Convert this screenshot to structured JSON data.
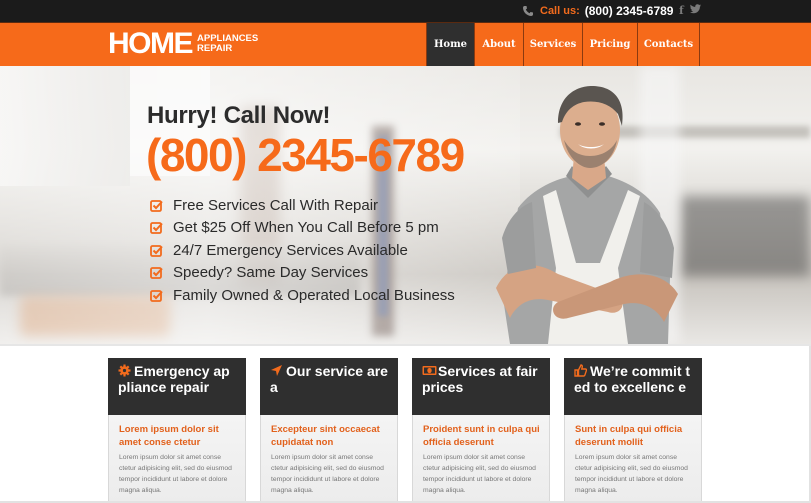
{
  "topbar": {
    "call_label": "Call us:",
    "call_number": "(800) 2345-6789",
    "social": [
      "f",
      "t"
    ],
    "icons": {
      "phone": "phone-icon",
      "facebook": "facebook-icon",
      "twitter": "twitter-icon"
    }
  },
  "header": {
    "logo_big": "HOME",
    "logo_line1": "APPLIANCES",
    "logo_line2": "REPAIR",
    "nav": [
      {
        "label": "Home",
        "active": true
      },
      {
        "label": "About",
        "active": false
      },
      {
        "label": "Services",
        "active": false
      },
      {
        "label": "Pricing",
        "active": false
      },
      {
        "label": "Contacts",
        "active": false
      }
    ]
  },
  "hero": {
    "headline": "Hurry! Call Now!",
    "phone": "(800) 2345-6789",
    "features": [
      "Free Services Call With Repair",
      "Get $25 Off When You Call Before 5 pm",
      "24/7 Emergency Services Available",
      "Speedy? Same Day Services",
      "Family Owned & Operated Local Business"
    ],
    "check_icon": "checkbox-checked-icon"
  },
  "cards": [
    {
      "icon": "gear-icon",
      "title": "Emergency appliance repair",
      "subtitle": "Lorem ipsum dolor sit amet conse ctetur",
      "text": "Lorem ipsum dolor sit amet conse ctetur adipisicing elit, sed do eiusmod tempor incididunt ut labore et dolore magna aliqua."
    },
    {
      "icon": "location-arrow-icon",
      "title": "Our service area",
      "subtitle": "Excepteur sint occaecat cupidatat non",
      "text": "Lorem ipsum dolor sit amet conse ctetur adipisicing elit, sed do eiusmod tempor incididunt ut labore et dolore magna aliqua."
    },
    {
      "icon": "money-icon",
      "title": "Services at fair prices",
      "subtitle": "Proident sunt in culpa qui officia deserunt",
      "text": "Lorem ipsum dolor sit amet conse ctetur adipisicing elit, sed do eiusmod tempor incididunt ut labore et dolore magna aliqua."
    },
    {
      "icon": "thumbs-up-icon",
      "title": "We’re commit ted to excellenc e",
      "subtitle": "Sunt in culpa qui officia deserunt mollit",
      "text": "Lorem ipsum dolor sit amet conse ctetur adipisicing elit, sed do eiusmod tempor incididunt ut labore et dolore magna aliqua."
    }
  ],
  "colors": {
    "accent": "#f66a1a",
    "dark": "#2f2f2f",
    "topbar": "#1b1b1b"
  }
}
